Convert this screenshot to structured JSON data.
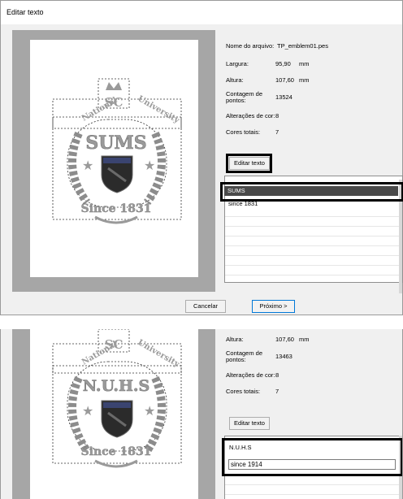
{
  "dialog_title": "Editar texto",
  "top": {
    "file_label": "Nome do arquivo:",
    "file_value": "TP_emblem01.pes",
    "width_label": "Largura:",
    "width_value": "95,90",
    "width_unit": "mm",
    "height_label": "Altura:",
    "height_value": "107,60",
    "height_unit": "mm",
    "stitch_label_1": "Contagem de",
    "stitch_label_2": "pontos:",
    "stitch_value": "13524",
    "color_changes_label": "Alterações de cor:",
    "color_changes_value": "8",
    "total_colors_label": "Cores totais:",
    "total_colors_value": "7",
    "edit_text_button": "Editar texto",
    "text_items": [
      "SUMS",
      "since 1831"
    ],
    "cancel_button": "Cancelar",
    "next_button": "Próximo >",
    "emblem": {
      "arc_left": "National",
      "arc_right": "University",
      "center": "SUMS",
      "bottom": "Since 1831",
      "monogram": "SC"
    }
  },
  "bottom": {
    "height_label": "Altura:",
    "height_value": "107,60",
    "height_unit": "mm",
    "stitch_label_1": "Contagem de",
    "stitch_label_2": "pontos:",
    "stitch_value": "13463",
    "color_changes_label": "Alterações de cor:",
    "color_changes_value": "8",
    "total_colors_label": "Cores totais:",
    "total_colors_value": "7",
    "edit_text_button": "Editar texto",
    "text_item_1": "N.U.H.S",
    "text_input_value": "since 1914",
    "emblem": {
      "arc_left": "National",
      "arc_right": "University",
      "center": "N.U.H.S",
      "bottom": "Since 1831",
      "monogram": "SC"
    }
  }
}
